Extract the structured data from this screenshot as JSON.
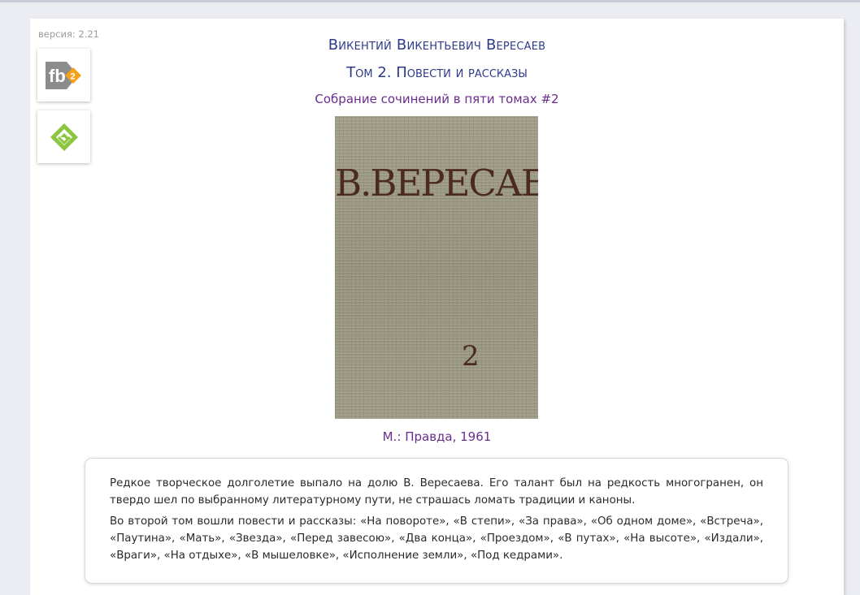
{
  "version": "версия: 2.21",
  "downloads": {
    "fb2": {
      "icon": "fb2-icon",
      "badge": "2",
      "label": "fb"
    },
    "epub": {
      "icon": "epub-icon"
    }
  },
  "book": {
    "author": "Викентий Викентьевич Вересаев",
    "title": "Том 2. Повести и рассказы",
    "series": "Собрание сочинений в пяти томах #2",
    "cover": {
      "author_text": "В.ВЕРЕСАЕВ",
      "volume": "2",
      "color": "#9d9a86",
      "text_color": "#4b2a22"
    },
    "publisher": "М.: Правда, 1961"
  },
  "annotation": {
    "paragraphs": [
      "Редкое творческое долголетие выпало на долю В. Вересаева. Его талант был на редкость многогранен, он твердо шел по выбранному литературному пути, не страшась ломать традиции и каноны.",
      "Во второй том вошли повести и рассказы: «На повороте», «В степи», «За права», «Об одном доме», «Встреча», «Паутина», «Мать», «Звезда», «Перед завесою», «Два конца», «Проездом», «В путах», «На высоте», «Издали», «Враги», «На отдыхе», «В мышеловке», «Исполнение земли», «Под кедрами»."
    ]
  },
  "colors": {
    "title": "#2e3a8c",
    "link": "#6a2d8e",
    "fb2_orange": "#f4a21c",
    "epub_green": "#8cc63f"
  }
}
